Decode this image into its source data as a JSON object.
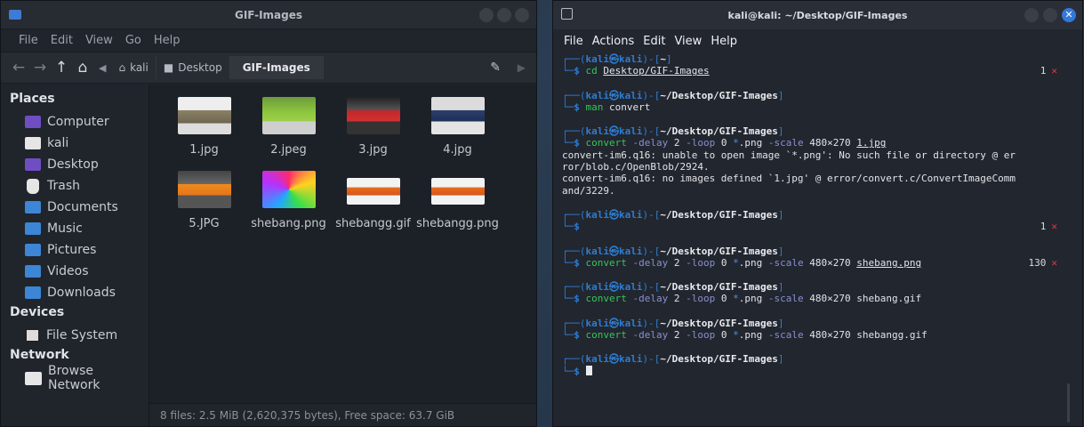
{
  "file_manager": {
    "title": "GIF-Images",
    "menu": [
      "File",
      "Edit",
      "View",
      "Go",
      "Help"
    ],
    "breadcrumbs": [
      "kali",
      "Desktop",
      "GIF-Images"
    ],
    "sidebar": {
      "places_heading": "Places",
      "places": [
        "Computer",
        "kali",
        "Desktop",
        "Trash",
        "Documents",
        "Music",
        "Pictures",
        "Videos",
        "Downloads"
      ],
      "devices_heading": "Devices",
      "devices": [
        "File System"
      ],
      "network_heading": "Network",
      "network": [
        "Browse Network"
      ]
    },
    "files": [
      "1.jpg",
      "2.jpeg",
      "3.jpg",
      "4.jpg",
      "5.JPG",
      "shebang.png",
      "shebangg.gif",
      "shebangg.png"
    ],
    "status": "8 files: 2.5 MiB (2,620,375 bytes), Free space: 63.7 GiB"
  },
  "terminal": {
    "title": "kali@kali: ~/Desktop/GIF-Images",
    "menu": [
      "File",
      "Actions",
      "Edit",
      "View",
      "Help"
    ],
    "prompt_user": "kali",
    "prompt_host": "kali",
    "prompt_home": "~",
    "prompt_dir": "~/Desktop/GIF-Images",
    "cmd1": {
      "cmd": "cd",
      "arg": "Desktop/GIF-Images",
      "exit": "1"
    },
    "cmd2": {
      "cmd": "man",
      "arg": "convert"
    },
    "cmd3": {
      "cmd": "convert",
      "o1": "-delay",
      "v1": "2",
      "o2": "-loop",
      "v2": "0",
      "glob": "*",
      "ext": ".png",
      "o3": "-scale",
      "size": "480×270",
      "out": "1.jpg",
      "err1": "convert-im6.q16: unable to open image `*.png': No such file or directory @ er",
      "err2": "ror/blob.c/OpenBlob/2924.",
      "err3": "convert-im6.q16: no images defined `1.jpg' @ error/convert.c/ConvertImageComm",
      "err4": "and/3229."
    },
    "cmd4": {
      "exit": "1"
    },
    "cmd5": {
      "out": "shebang.png",
      "exit": "130"
    },
    "cmd6": {
      "out": "shebang.gif"
    },
    "cmd7": {
      "out": "shebangg.gif"
    }
  }
}
